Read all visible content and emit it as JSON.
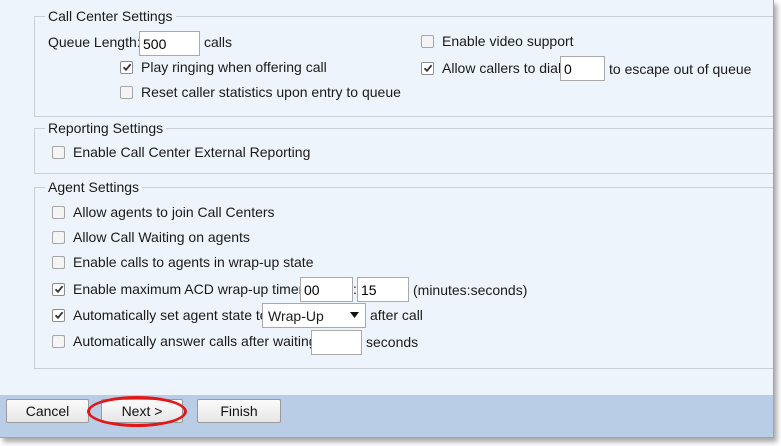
{
  "call_center": {
    "legend": "Call Center Settings",
    "queue_length_label": "Queue Length:",
    "queue_length_value": "500",
    "queue_length_unit": "calls",
    "play_ringing": {
      "label": "Play ringing when offering call",
      "checked": true
    },
    "reset_stats": {
      "label": "Reset caller statistics upon entry to queue",
      "checked": false
    },
    "video_support": {
      "label": "Enable video support",
      "checked": false
    },
    "escape": {
      "label": "Allow callers to dial",
      "value": "0",
      "suffix": "to escape out of queue",
      "checked": true
    }
  },
  "reporting": {
    "legend": "Reporting Settings",
    "external_reporting": {
      "label": "Enable Call Center External Reporting",
      "checked": false
    }
  },
  "agent": {
    "legend": "Agent Settings",
    "join_centers": {
      "label": "Allow agents to join Call Centers",
      "checked": false
    },
    "call_waiting": {
      "label": "Allow Call Waiting on agents",
      "checked": false
    },
    "wrapup_calls": {
      "label": "Enable calls to agents in wrap-up state",
      "checked": false
    },
    "acd_timer": {
      "label": "Enable maximum ACD wrap-up timer:",
      "minutes": "00",
      "separator": ":",
      "seconds": "15",
      "unit": "(minutes:seconds)",
      "checked": true
    },
    "auto_state": {
      "label": "Automatically set agent state to",
      "selected": "Wrap-Up",
      "suffix": "after call",
      "checked": true
    },
    "auto_answer": {
      "label": "Automatically answer calls after waiting",
      "value": "",
      "suffix": "seconds",
      "checked": false
    }
  },
  "buttons": {
    "cancel": "Cancel",
    "next": "Next >",
    "finish": "Finish"
  },
  "colors": {
    "background": "#eef4fb",
    "footer": "#b9cde6",
    "highlight": "#e01818"
  }
}
